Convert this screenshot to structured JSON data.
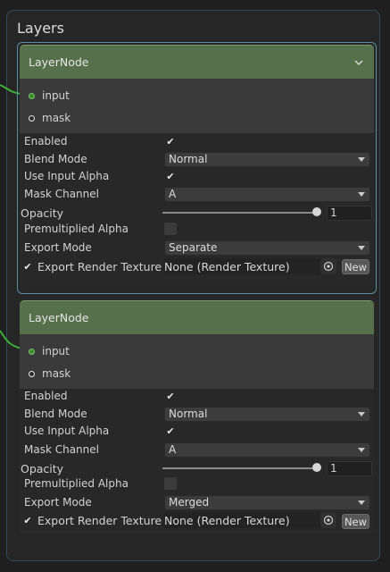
{
  "panel": {
    "title": "Layers"
  },
  "nodes": [
    {
      "title": "LayerNode",
      "ports": [
        "input",
        "mask"
      ],
      "props": {
        "enabled_label": "Enabled",
        "blend_label": "Blend Mode",
        "blend_value": "Normal",
        "alpha_label": "Use Input Alpha",
        "mask_label": "Mask Channel",
        "mask_value": "A",
        "opacity_label": "Opacity",
        "opacity_value": "1",
        "premul_label": "Premultiplied Alpha",
        "export_label": "Export Mode",
        "export_value": "Separate",
        "render_label": "Export Render Texture",
        "render_value": "None (Render Texture)",
        "new_label": "New"
      }
    },
    {
      "title": "LayerNode",
      "ports": [
        "input",
        "mask"
      ],
      "props": {
        "enabled_label": "Enabled",
        "blend_label": "Blend Mode",
        "blend_value": "Normal",
        "alpha_label": "Use Input Alpha",
        "mask_label": "Mask Channel",
        "mask_value": "A",
        "opacity_label": "Opacity",
        "opacity_value": "1",
        "premul_label": "Premultiplied Alpha",
        "export_label": "Export Mode",
        "export_value": "Merged",
        "render_label": "Export Render Texture",
        "render_value": "None (Render Texture)",
        "new_label": "New"
      }
    }
  ],
  "colors": {
    "header": "#56704c",
    "accent_border": "#5b8ea0",
    "wire": "#3fae3a"
  }
}
